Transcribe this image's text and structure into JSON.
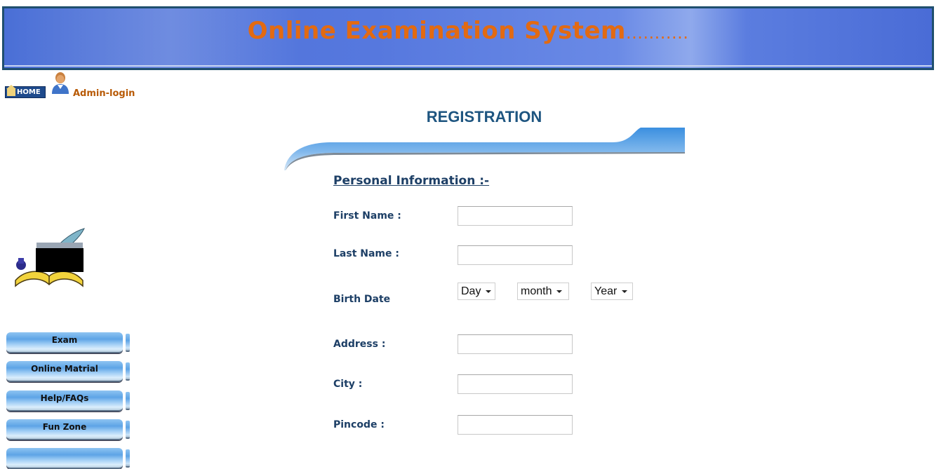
{
  "header": {
    "title": "Online Examination System",
    "title_suffix": "...........",
    "title_color": "#e26a12"
  },
  "topnav": {
    "home_label": "HOME",
    "home_prefix": "en",
    "admin_label": "Admin-login"
  },
  "page": {
    "heading": "REGISTRATION",
    "section_title": "Personal Information :-"
  },
  "form": {
    "first_name": {
      "label": "First Name :",
      "value": ""
    },
    "last_name": {
      "label": "Last Name :",
      "value": ""
    },
    "birth_date": {
      "label": "Birth Date",
      "day": "Day",
      "month": "month",
      "year": "Year"
    },
    "address": {
      "label": "Address :",
      "value": ""
    },
    "city": {
      "label": "City :",
      "value": ""
    },
    "pincode": {
      "label": "Pincode :",
      "value": ""
    }
  },
  "sidebar": {
    "items": [
      {
        "label": "Exam"
      },
      {
        "label": "Online Matrial"
      },
      {
        "label": "Help/FAQs"
      },
      {
        "label": "Fun Zone"
      },
      {
        "label": ""
      }
    ]
  },
  "colors": {
    "banner": "#4a6fd6",
    "heading": "#1e5580",
    "label": "#1d3f66",
    "admin_link": "#b85a06"
  }
}
